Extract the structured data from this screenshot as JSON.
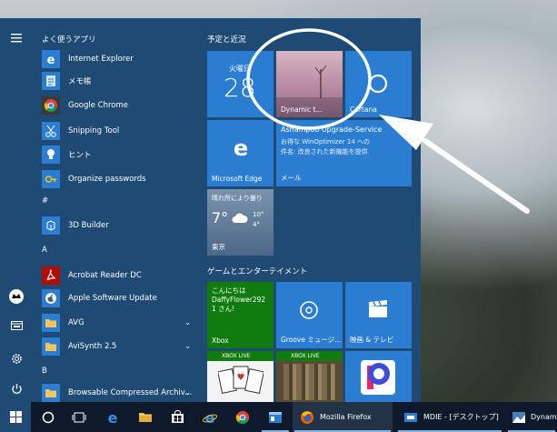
{
  "start_menu": {
    "most_used_title": "よく使うアプリ",
    "apps": [
      {
        "label": "Internet Explorer",
        "icon": "internet-explorer-icon"
      },
      {
        "label": "メモ帳",
        "icon": "notepad-icon"
      },
      {
        "label": "Google Chrome",
        "icon": "chrome-icon"
      },
      {
        "label": "Snipping Tool",
        "icon": "snipping-tool-icon"
      },
      {
        "label": "ヒント",
        "icon": "tips-icon"
      },
      {
        "label": "Organize passwords",
        "icon": "key-icon"
      }
    ],
    "group_hash": "#",
    "hash_apps": [
      {
        "label": "3D Builder",
        "icon": "3d-builder-icon"
      }
    ],
    "group_a": "A",
    "a_apps": [
      {
        "label": "Acrobat Reader DC",
        "icon": "acrobat-icon"
      },
      {
        "label": "Apple Software Update",
        "icon": "apple-update-icon"
      },
      {
        "label": "AVG",
        "icon": "folder-icon"
      },
      {
        "label": "AviSynth 2.5",
        "icon": "folder-icon"
      }
    ],
    "group_b": "B",
    "b_apps": [
      {
        "label": "Browsable Compressed Archiv...",
        "icon": "folder-icon"
      }
    ],
    "recent_title": "予定と近況",
    "games_title": "ゲームとエンターテイメント",
    "tiles": {
      "calendar_day": "火曜日",
      "calendar_date": "28",
      "dynamic_label": "Dynamic t...",
      "cortana_label": "Cortana",
      "edge_label": "Microsoft Edge",
      "mail_line1": "Ashampoo Upgrade-Service",
      "mail_line2": "お得な WinOptimizer 14 への",
      "mail_line3": "件名: 改良された新機能を提供",
      "mail_label": "メール",
      "weather_desc": "晴れ所により曇り",
      "weather_temp": "7°",
      "weather_high": "10°",
      "weather_low": "4°",
      "weather_city": "東京",
      "xbox_greeting1": "こんにちは",
      "xbox_greeting2": "DaffyFlower292",
      "xbox_greeting3": "1 さん!",
      "xbox_label": "Xbox",
      "groove_label": "Groove ミュージ...",
      "movies_label": "映画 & テレビ",
      "xbox_live1": "XBOX LIVE",
      "xbox_live2": "XBOX LIVE"
    }
  },
  "taskbar": {
    "firefox_task": "Mozilla Firefox",
    "mdie_task": "MDIE - [デスクトップ]",
    "dynamic_task": "Dynami"
  },
  "colors": {
    "start_bg": "#1f4a73",
    "tile_blue": "#2a7dd1",
    "xbox_green": "#107c10",
    "taskbar": "#0e1a2b"
  }
}
